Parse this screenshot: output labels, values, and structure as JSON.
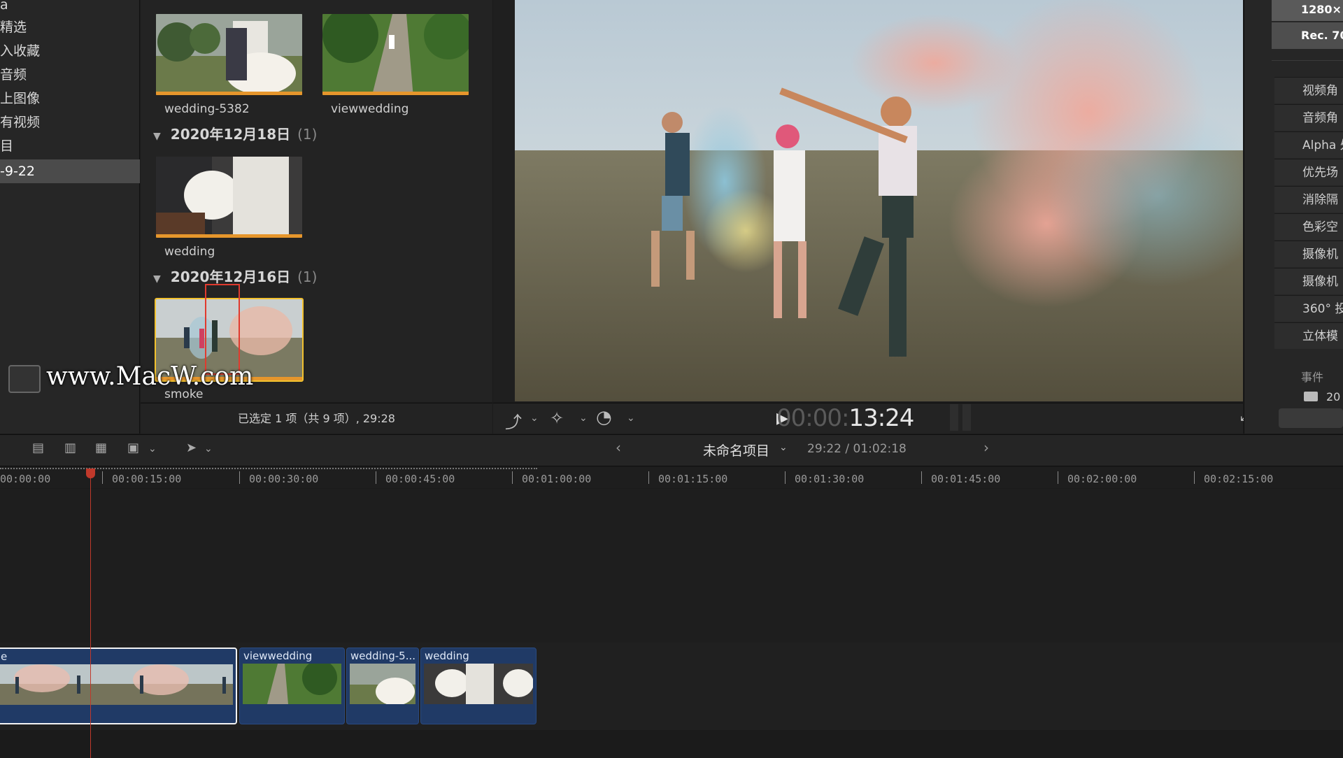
{
  "sidebar": {
    "items": [
      {
        "label": "a"
      },
      {
        "label": "精选"
      },
      {
        "label": "入收藏"
      },
      {
        "label": "音频"
      },
      {
        "label": "上图像"
      },
      {
        "label": "有视频"
      },
      {
        "label": "目"
      },
      {
        "label": "-9-22",
        "selected": true
      }
    ]
  },
  "browser": {
    "clips_row1": [
      {
        "name": "wedding-5382"
      },
      {
        "name": "viewwedding"
      }
    ],
    "group1": {
      "date": "2020年12月18日",
      "count": "(1)",
      "clip": "wedding"
    },
    "group2": {
      "date": "2020年12月16日",
      "count": "(1)",
      "clip": "smoke"
    },
    "status": "已选定 1 项（共 9 项）, 29:28"
  },
  "viewer": {
    "timecode_dim": "00:00:",
    "timecode": "13:24"
  },
  "inspector": {
    "top": [
      "1280×",
      "Rec. 70"
    ],
    "rows": [
      "视频角",
      "音频角",
      "Alpha 处",
      "优先场",
      "消除隔",
      "色彩空",
      "摄像机",
      "摄像机",
      "360° 投",
      "立体模"
    ],
    "section": "事件",
    "section_value": "20"
  },
  "timeline": {
    "project_name": "未命名项目",
    "duration": "29:22 / 01:02:18",
    "ruler": [
      "00:00:00",
      "00:00:15:00",
      "00:00:30:00",
      "00:00:45:00",
      "00:01:00:00",
      "00:01:15:00",
      "00:01:30:00",
      "00:01:45:00",
      "00:02:00:00",
      "00:02:15:00"
    ],
    "clips": [
      {
        "label": "e"
      },
      {
        "label": "viewwedding"
      },
      {
        "label": "wedding-5..."
      },
      {
        "label": "wedding"
      }
    ]
  },
  "watermark": "www.MacW.com",
  "colors": {
    "accent_orange": "#e6962c",
    "selection_yellow": "#f2c12e",
    "clip_blue": "#203a66",
    "playhead_red": "#c0392b"
  }
}
